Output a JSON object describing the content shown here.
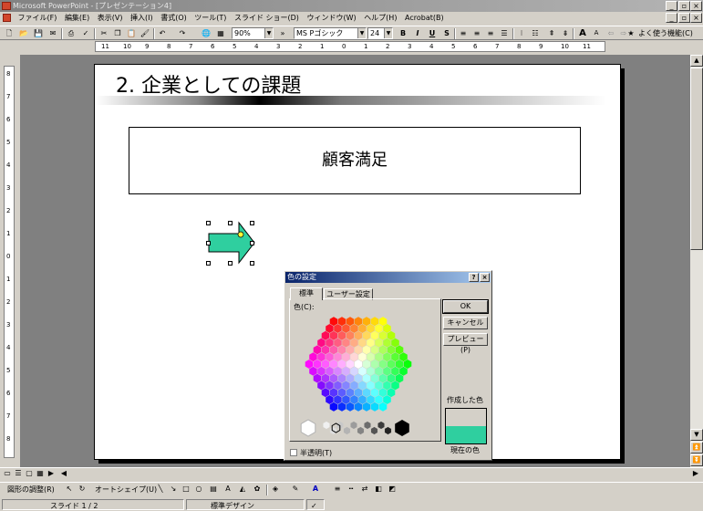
{
  "window": {
    "title": "Microsoft PowerPoint - [プレゼンテーション4]"
  },
  "menu": {
    "items": [
      "ファイル(F)",
      "編集(E)",
      "表示(V)",
      "挿入(I)",
      "書式(O)",
      "ツール(T)",
      "スライド ショー(D)",
      "ウィンドウ(W)",
      "ヘルプ(H)",
      "Acrobat(B)"
    ]
  },
  "toolbar": {
    "zoom": "90%",
    "font": "MS Pゴシック",
    "font_size": "24",
    "bold": "B",
    "italic": "I",
    "underline": "U",
    "shadow": "S",
    "grow_font": "A",
    "frequent_label": "よく使う機能(C)"
  },
  "ruler": {
    "h_labels": [
      "11",
      "10",
      "9",
      "8",
      "7",
      "6",
      "5",
      "4",
      "3",
      "2",
      "1",
      "0",
      "1",
      "2",
      "3",
      "4",
      "5",
      "6",
      "7",
      "8",
      "9",
      "10",
      "11"
    ],
    "v_labels": [
      "8",
      "7",
      "6",
      "5",
      "4",
      "3",
      "2",
      "1",
      "0",
      "1",
      "2",
      "3",
      "4",
      "5",
      "6",
      "7",
      "8"
    ]
  },
  "slide": {
    "title": "2. 企業としての課題",
    "box_text": "顧客満足",
    "arrow_color": "#2fcf9f"
  },
  "dialog": {
    "title": "色の設定",
    "help": "?",
    "close": "×",
    "tabs": [
      "標準",
      "ユーザー設定"
    ],
    "colors_label": "色(C):",
    "ok": "OK",
    "cancel": "キャンセル",
    "preview": "プレビュー(P)",
    "new_label": "作成した色",
    "current_label": "現在の色",
    "semi_transparent": "半透明(T)",
    "new_color": "#d4d0c8",
    "current_color": "#2fcf9f"
  },
  "drawbar": {
    "draw": "図形の調整(R)",
    "autoshapes": "オートシェイプ(U)"
  },
  "status": {
    "slide": "スライド 1 / 2",
    "design": "標準デザイン"
  }
}
